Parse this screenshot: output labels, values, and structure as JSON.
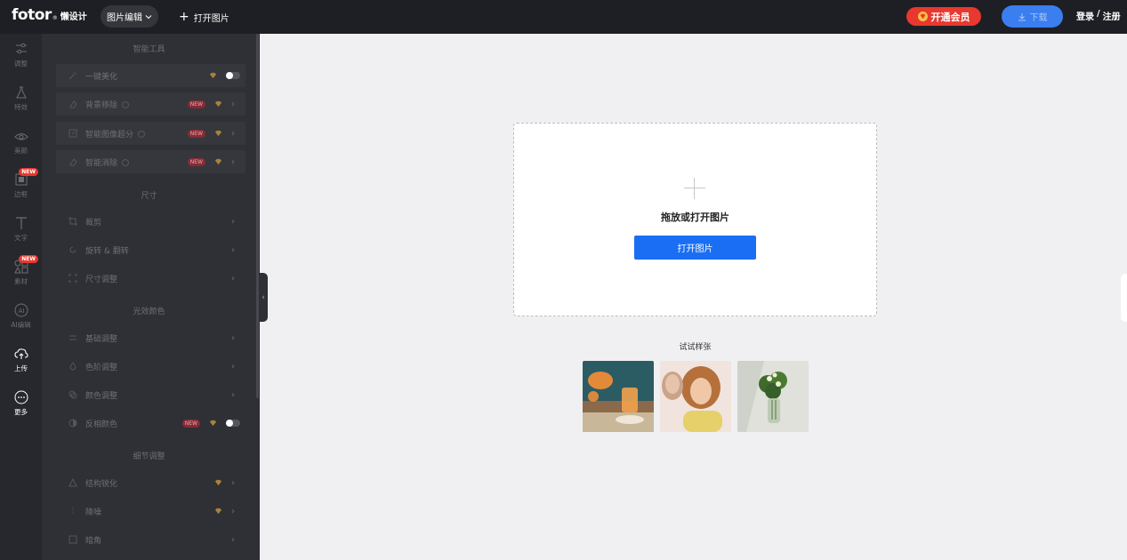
{
  "header": {
    "logo_brand": "fotor",
    "logo_cn": "懒设计",
    "mode_select": "图片编辑",
    "open_image": "打开图片",
    "vip_button": "开通会员",
    "download_button": "下载",
    "login": "登录",
    "separator": "/",
    "register": "注册"
  },
  "rail": {
    "items": [
      {
        "label": "调整",
        "icon": "sliders-icon",
        "active": false
      },
      {
        "label": "特效",
        "icon": "flask-icon",
        "active": false
      },
      {
        "label": "美颜",
        "icon": "eye-icon",
        "active": false
      },
      {
        "label": "边框",
        "icon": "frame-icon",
        "active": false,
        "badge": "NEW"
      },
      {
        "label": "文字",
        "icon": "text-icon",
        "active": false
      },
      {
        "label": "素材",
        "icon": "shapes-icon",
        "active": false,
        "badge": "NEW"
      },
      {
        "label": "AI编辑",
        "icon": "ai-icon",
        "active": false
      },
      {
        "label": "上传",
        "icon": "cloud-upload-icon",
        "active": true
      },
      {
        "label": "更多",
        "icon": "more-icon",
        "active": true
      }
    ]
  },
  "panel": {
    "sections": {
      "smart": "智能工具",
      "size": "尺寸",
      "light": "光效颜色",
      "detail": "细节调整"
    },
    "tools": {
      "beautify": "一键美化",
      "bg_remove": "背景移除",
      "upscale": "智能图像超分",
      "erase": "智能消除",
      "crop": "裁剪",
      "rotate": "旋转 & 翻转",
      "resize": "尺寸调整",
      "basic": "基础调整",
      "levels": "色阶调整",
      "color": "颜色调整",
      "invert": "反相颜色",
      "sharpen": "结构锐化",
      "denoise": "降噪",
      "vignette": "暗角"
    },
    "new_badge": "NEW"
  },
  "canvas": {
    "drop_text": "拖放或打开图片",
    "open_button": "打开图片",
    "samples_title": "试试样张"
  },
  "colors": {
    "accent": "#1a6ef4",
    "vip": "#e8382f",
    "topbar": "#1e1f24",
    "panel": "#2f3035",
    "premium_gem": "#a8823a"
  }
}
